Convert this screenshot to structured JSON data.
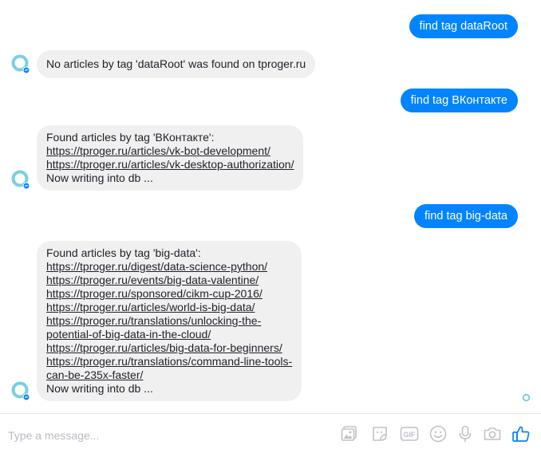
{
  "messages": {
    "m1_out": "find tag dataRoot",
    "m2_in": "No articles by tag 'dataRoot' was found on tproger.ru",
    "m3_out": "find tag ВКонтакте",
    "m4_in": {
      "header": "Found articles by tag 'ВКонтакте':",
      "links": [
        "https://tproger.ru/articles/vk-bot-development/",
        "https://tproger.ru/articles/vk-desktop-authorization/"
      ],
      "footer": "Now writing into db ..."
    },
    "m5_out": "find tag big-data",
    "m6_in": {
      "header": "Found articles by tag 'big-data':",
      "links": [
        "https://tproger.ru/digest/data-science-python/",
        "https://tproger.ru/events/big-data-valentine/",
        "https://tproger.ru/sponsored/cikm-cup-2016/",
        "https://tproger.ru/articles/world-is-big-data/",
        "https://tproger.ru/translations/unlocking-the-",
        "potential-of-big-data-in-the-cloud/",
        "https://tproger.ru/articles/big-data-for-beginners/",
        "https://tproger.ru/translations/command-line-tools-",
        "can-be-235x-faster/"
      ],
      "footer": "Now writing into db ..."
    }
  },
  "composer": {
    "placeholder": "Type a message...",
    "tools": [
      "image-icon",
      "sticker-icon",
      "gif-icon",
      "emoji-icon",
      "microphone-icon",
      "camera-icon",
      "like-icon"
    ]
  },
  "colors": {
    "accent": "#0084ff",
    "incoming_bubble": "#f1f0f0",
    "placeholder": "#b7bbc2",
    "icon": "#bec2c9"
  }
}
